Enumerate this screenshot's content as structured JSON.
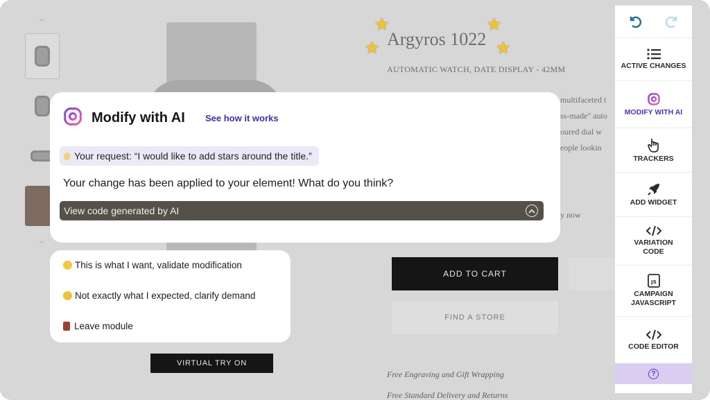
{
  "product": {
    "title": "Argyros 1022",
    "subtitle": "AUTOMATIC WATCH, DATE DISPLAY - 42MM",
    "description_fragments": [
      "multifaceted t",
      "ss-made\" auto",
      "oured dial w",
      "eople lookin"
    ],
    "pay_fragment": "y now",
    "add_to_cart": "ADD TO CART",
    "find_store": "FIND A STORE",
    "virtual_try_on": "VIRTUAL TRY ON",
    "perks": [
      "Free Engraving and Gift Wrapping",
      "Free Standard Delivery and Returns"
    ]
  },
  "ai_panel": {
    "title": "Modify with AI",
    "link": "See how it works",
    "request": "Your request: “I would like to add stars around the title.”",
    "result": "Your change has been applied to your element! What do you think?",
    "code_toggle": "View code generated by AI"
  },
  "choices": [
    {
      "label": "This is what I want, validate modification",
      "icon": "smiling-face-icon"
    },
    {
      "label": "Not exactly what I expected, clarify demand",
      "icon": "confused-face-icon"
    },
    {
      "label": "Leave module",
      "icon": "door-icon"
    }
  ],
  "toolbar": {
    "items": [
      {
        "label": "ACTIVE CHANGES",
        "icon": "list-icon"
      },
      {
        "label": "MODIFY WITH AI",
        "icon": "ai-logo-icon",
        "active": true
      },
      {
        "label": "TRACKERS",
        "icon": "pointer-hand-icon"
      },
      {
        "label": "ADD WIDGET",
        "icon": "rocket-icon"
      },
      {
        "label": "VARIATION\nCODE",
        "icon": "code-icon"
      },
      {
        "label": "CAMPAIGN\nJAVASCRIPT",
        "icon": "js-file-icon"
      },
      {
        "label": "CODE EDITOR",
        "icon": "code-icon"
      }
    ]
  },
  "colors": {
    "accent": "#5b2fd6",
    "overlay": "#d7d7d7",
    "star": "#f4c430",
    "code_bar": "#555149"
  }
}
